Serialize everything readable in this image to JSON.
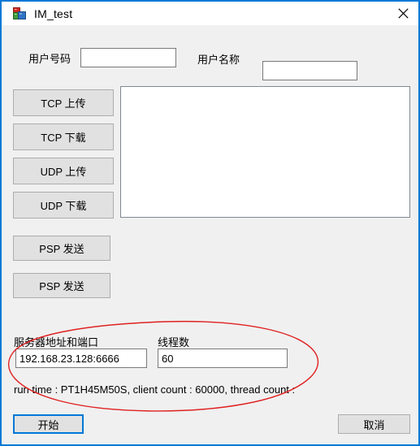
{
  "window": {
    "title": "IM_test",
    "icon": "app-cubes-icon",
    "close_label": "✕",
    "accent_color": "#0078d7",
    "client_bg": "#f0f0f0"
  },
  "form": {
    "user_number": {
      "label": "用户号码",
      "value": "",
      "placeholder": ""
    },
    "user_name": {
      "label": "用户名称",
      "value": "",
      "placeholder": ""
    },
    "server_address": {
      "label": "服务器地址和端口",
      "value": "192.168.23.128:6666",
      "placeholder": ""
    },
    "thread_count": {
      "label": "线程数",
      "value": "60",
      "placeholder": ""
    }
  },
  "actions": {
    "tcp_upload": "TCP 上传",
    "tcp_download": "TCP 下载",
    "udp_upload": "UDP 上传",
    "udp_download": "UDP 下载",
    "psp_send_1": "PSP 发送",
    "psp_send_2": "PSP 发送",
    "start": "开始",
    "cancel": "取消"
  },
  "log": {
    "content": ""
  },
  "status": {
    "text": "run time : PT1H45M50S, client count : 60000, thread count :",
    "run_time": "PT1H45M50S",
    "client_count": "60000",
    "thread_count": ""
  },
  "annotation": {
    "type": "hand-drawn-ellipse",
    "color": "#e02020"
  }
}
